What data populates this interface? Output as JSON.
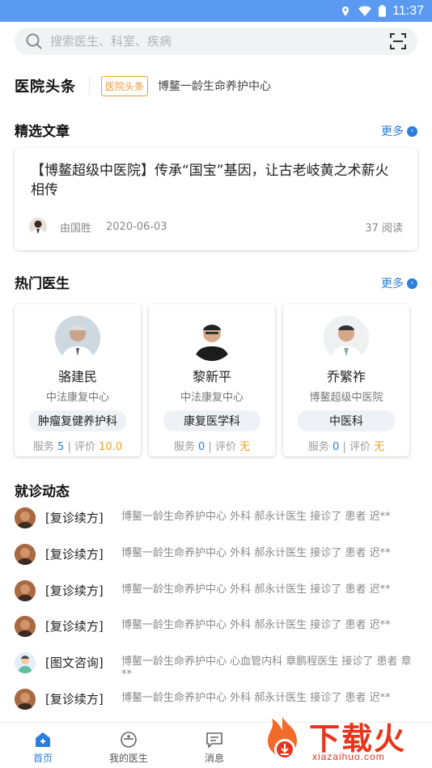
{
  "status_bar": {
    "time": "11:37"
  },
  "search": {
    "placeholder": "搜索医生、科室、疾病"
  },
  "headline": {
    "logo": "医院头条",
    "badge": "医院头条",
    "text": "博鳌一龄生命养护中心"
  },
  "featured": {
    "title": "精选文章",
    "more": "更多",
    "article": {
      "title": "【博鳌超级中医院】传承“国宝”基因，让古老岐黄之术薪火相传",
      "author": "由国胜",
      "date": "2020-06-03",
      "reads": "37 阅读"
    }
  },
  "hot_doctors": {
    "title": "热门医生",
    "more": "更多",
    "doctors": [
      {
        "name": "骆建民",
        "org": "中法康复中心",
        "dept": "肿瘤复健养护科",
        "service_label": "服务",
        "service": "5",
        "rating_label": "评价",
        "rating": "10.0"
      },
      {
        "name": "黎新平",
        "org": "中法康复中心",
        "dept": "康复医学科",
        "service_label": "服务",
        "service": "0",
        "rating_label": "评价",
        "rating": "无"
      },
      {
        "name": "乔繁祚",
        "org": "博鳌超级中医院",
        "dept": "中医科",
        "service_label": "服务",
        "service": "0",
        "rating_label": "评价",
        "rating": "无"
      }
    ]
  },
  "visits": {
    "title": "就诊动态",
    "items": [
      {
        "tag": "[复诊续方]",
        "text": "博鳌一龄生命养护中心 外科 郝永计医生 接诊了 患者 迟**"
      },
      {
        "tag": "[复诊续方]",
        "text": "博鳌一龄生命养护中心 外科 郝永计医生 接诊了 患者 迟**"
      },
      {
        "tag": "[复诊续方]",
        "text": "博鳌一龄生命养护中心 外科 郝永计医生 接诊了 患者 迟**"
      },
      {
        "tag": "[复诊续方]",
        "text": "博鳌一龄生命养护中心 外科 郝永计医生 接诊了 患者 迟**"
      },
      {
        "tag": "[图文咨询]",
        "text": "博鳌一龄生命养护中心 心血管内科 章鹏程医生 接诊了 患者 章**"
      },
      {
        "tag": "[复诊续方]",
        "text": "博鳌一龄生命养护中心 外科 郝永计医生 接诊了 患者 迟**"
      }
    ]
  },
  "tabbar": {
    "tabs": [
      "首页",
      "我的医生",
      "消息"
    ]
  },
  "watermark": {
    "text": "下载火",
    "url": "xiazaihuo.com"
  },
  "colors": {
    "accent": "#2d7ddc",
    "status_bar": "#5a9af0",
    "badge": "#f29a3a",
    "rating": "#f0a01e",
    "watermark": "#e8341c"
  }
}
